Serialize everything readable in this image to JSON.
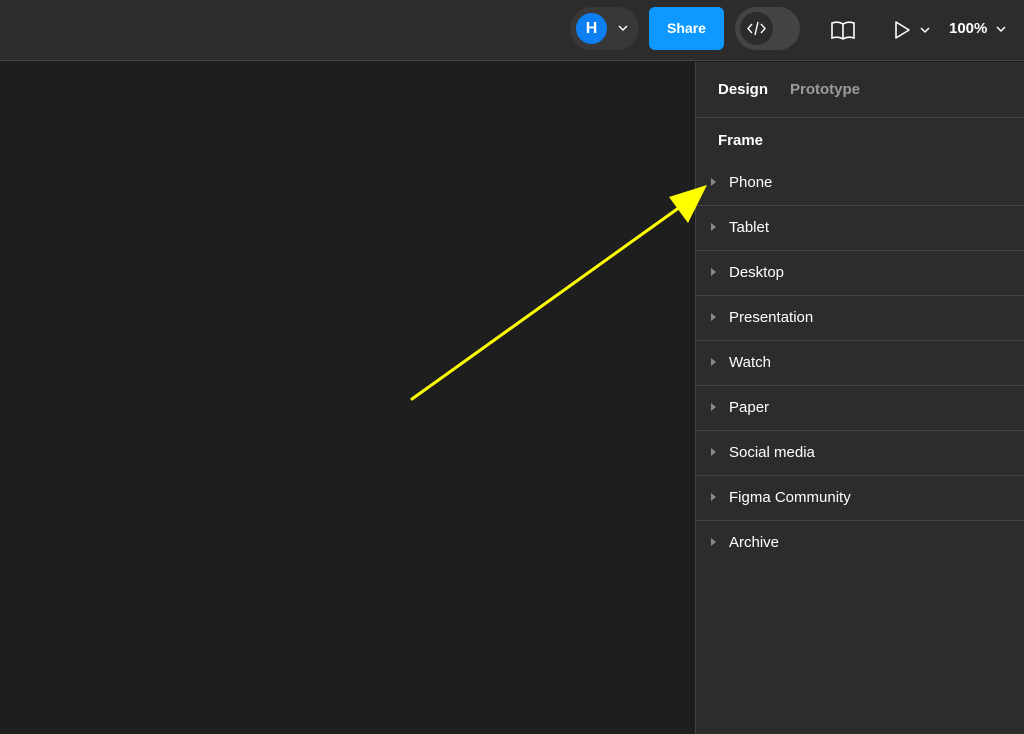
{
  "toolbar": {
    "avatar_initial": "H",
    "share_label": "Share",
    "zoom_label": "100%",
    "icons": [
      "chevron-down-icon",
      "code-icon",
      "book-icon",
      "play-icon"
    ]
  },
  "panel": {
    "tabs": [
      {
        "label": "Design",
        "active": true
      },
      {
        "label": "Prototype",
        "active": false
      }
    ],
    "section_title": "Frame",
    "frames": [
      {
        "label": "Phone"
      },
      {
        "label": "Tablet"
      },
      {
        "label": "Desktop"
      },
      {
        "label": "Presentation"
      },
      {
        "label": "Watch"
      },
      {
        "label": "Paper"
      },
      {
        "label": "Social media"
      },
      {
        "label": "Figma Community"
      },
      {
        "label": "Archive"
      }
    ]
  },
  "colors": {
    "canvas": "#1e1e1e",
    "panel": "#2c2c2c",
    "share_button": "#0d99ff",
    "avatar": "#0d7ff0",
    "annotation_arrow": "#ffff00"
  }
}
